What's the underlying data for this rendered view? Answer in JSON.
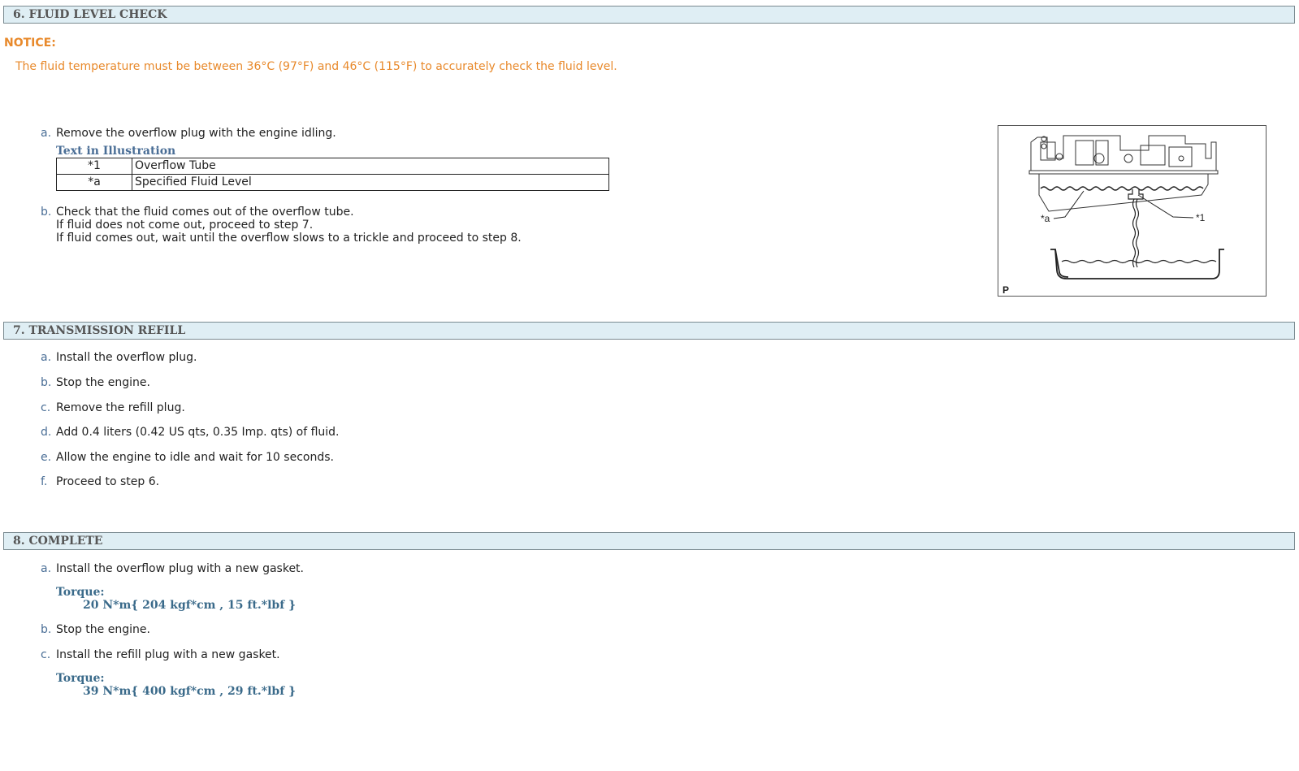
{
  "section6": {
    "title": "6. FLUID LEVEL CHECK",
    "notice_label": "NOTICE:",
    "notice_text": "The fluid temperature must be between 36°C (97°F) and 46°C (115°F) to accurately check the fluid level.",
    "step_a": {
      "letter": "a.",
      "text": "Remove the overflow plug with the engine idling."
    },
    "text_in_illustration": "Text in Illustration",
    "legend": [
      {
        "key": "*1",
        "label": "Overflow Tube"
      },
      {
        "key": "*a",
        "label": "Specified Fluid Level"
      }
    ],
    "step_b": {
      "letter": "b.",
      "lines": [
        "Check that the fluid comes out of the overflow tube.",
        "If fluid does not come out, proceed to step 7.",
        "If fluid comes out, wait until the overflow slows to a trickle and proceed to step 8."
      ]
    },
    "illustration": {
      "callout_a": "*a",
      "callout_1": "*1",
      "corner_mark": "P"
    }
  },
  "section7": {
    "title": "7. TRANSMISSION REFILL",
    "steps": [
      {
        "letter": "a.",
        "text": "Install the overflow plug."
      },
      {
        "letter": "b.",
        "text": "Stop the engine."
      },
      {
        "letter": "c.",
        "text": "Remove the refill plug."
      },
      {
        "letter": "d.",
        "text": "Add 0.4 liters (0.42 US qts, 0.35 Imp. qts) of fluid."
      },
      {
        "letter": "e.",
        "text": "Allow the engine to idle and wait for 10 seconds."
      },
      {
        "letter": "f.",
        "text": "Proceed to step 6."
      }
    ]
  },
  "section8": {
    "title": "8. COMPLETE",
    "steps": [
      {
        "letter": "a.",
        "text": "Install the overflow plug with a new gasket.",
        "torque_label": "Torque:",
        "torque_value": "20 N*m{ 204 kgf*cm , 15 ft.*lbf }"
      },
      {
        "letter": "b.",
        "text": "Stop the engine."
      },
      {
        "letter": "c.",
        "text": "Install the refill plug with a new gasket.",
        "torque_label": "Torque:",
        "torque_value": "39 N*m{ 400 kgf*cm , 29 ft.*lbf }"
      }
    ]
  }
}
